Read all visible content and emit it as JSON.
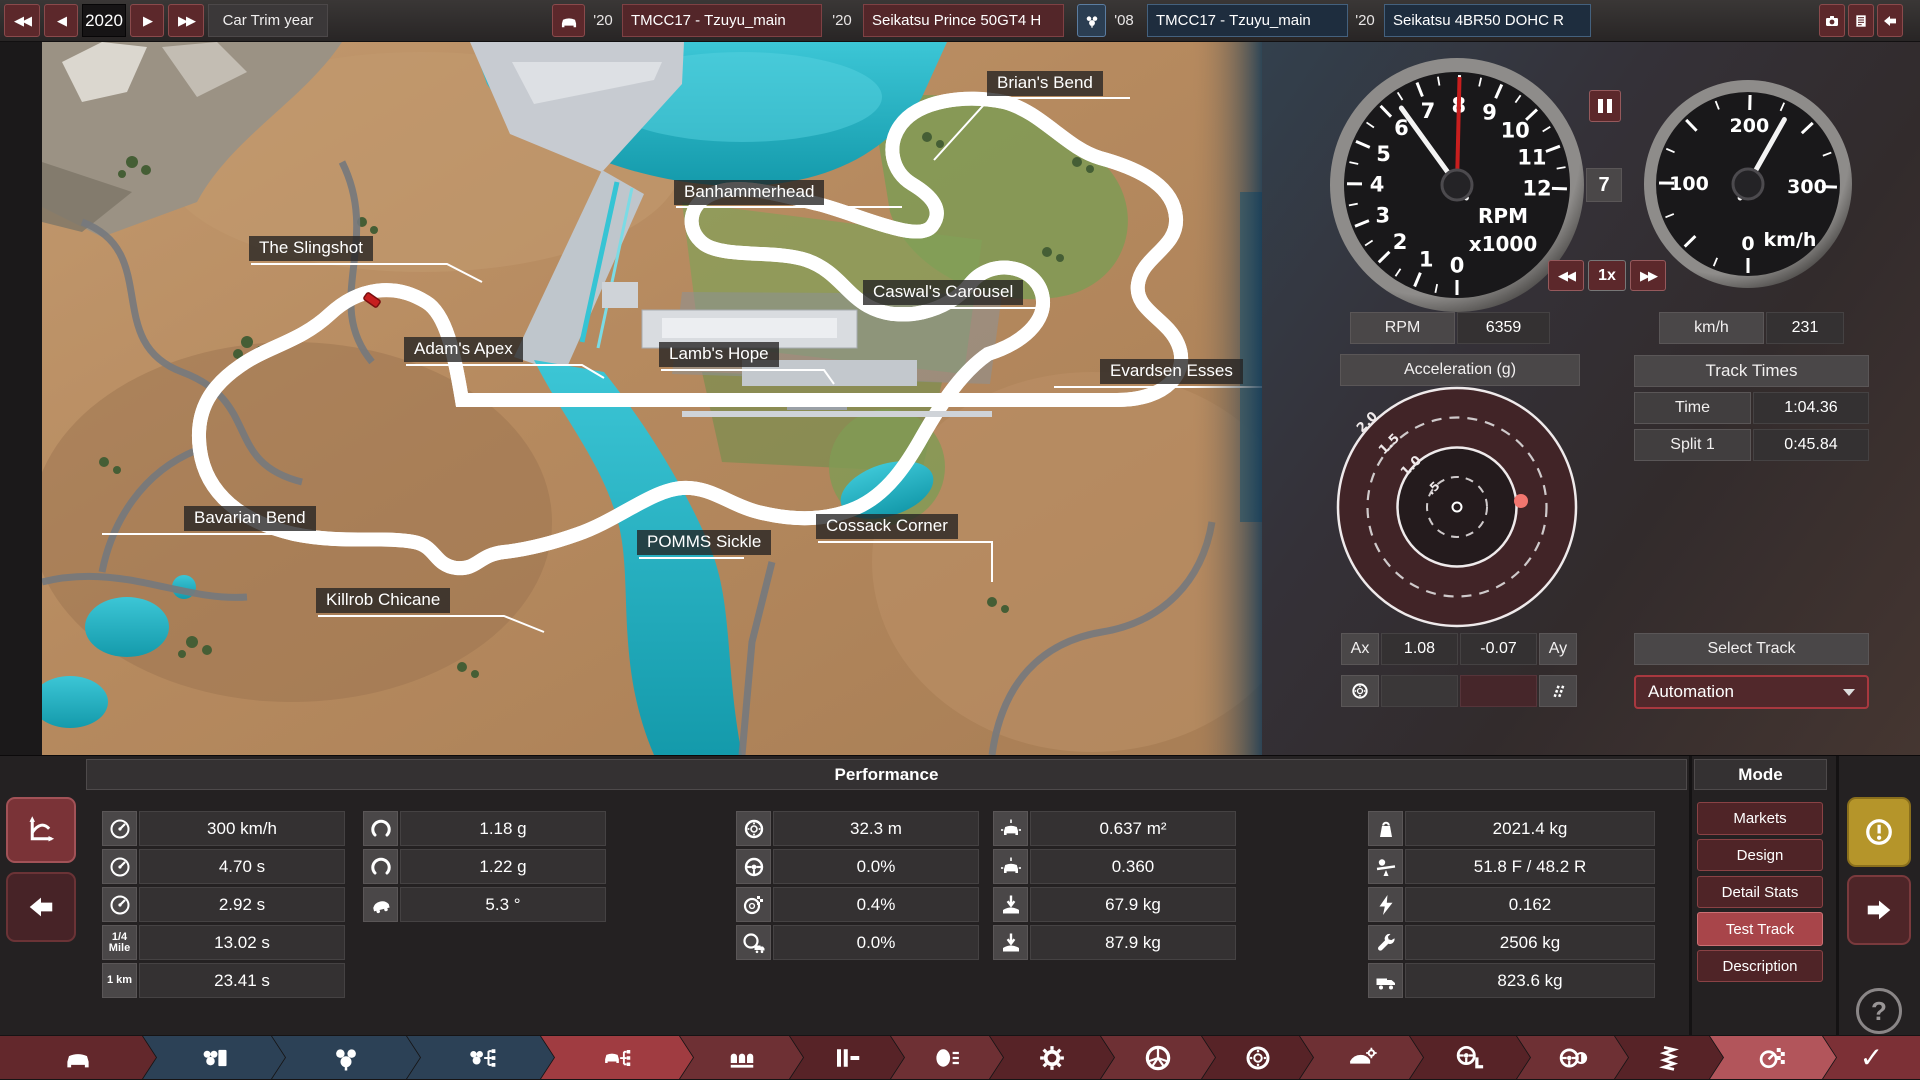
{
  "colors": {
    "accent_red": "#a03c41",
    "active_mode": "#a8454a",
    "warning_yellow": "#b5952a",
    "navy_tab": "#2c4156",
    "gmeter_dot": "#f2766f"
  },
  "top_bar": {
    "year": "2020",
    "year_nav_label": "Car Trim year",
    "tabs": [
      {
        "tag": "'20",
        "label": "TMCC17 - Tzuyu_main"
      },
      {
        "tag": "'20",
        "label": "Seikatsu Prince 50GT4 H"
      },
      {
        "tag": "'08",
        "label": "TMCC17 - Tzuyu_main"
      },
      {
        "tag": "'20",
        "label": "Seikatsu 4BR50 DOHC R"
      }
    ]
  },
  "map": {
    "corners": [
      {
        "name": "Brian's Bend"
      },
      {
        "name": "Banhammerhead"
      },
      {
        "name": "The Slingshot"
      },
      {
        "name": "Caswal's Carousel"
      },
      {
        "name": "Adam's Apex"
      },
      {
        "name": "Lamb's Hope"
      },
      {
        "name": "Evardsen Esses"
      },
      {
        "name": "Bavarian Bend"
      },
      {
        "name": "Cossack Corner"
      },
      {
        "name": "POMMS Sickle"
      },
      {
        "name": "Killrob Chicane"
      }
    ]
  },
  "dash": {
    "gear": "7",
    "playback_speed": "1x",
    "rpm_label": "RPM",
    "rpm_value": "6359",
    "kmh_label": "km/h",
    "kmh_value": "231",
    "accel_header": "Acceleration (g)",
    "g_rings": [
      "2.0",
      "1.5",
      "1.0",
      ".5"
    ],
    "track_times_header": "Track Times",
    "time_label": "Time",
    "time_value": "1:04.36",
    "split_label": "Split 1",
    "split_value": "0:45.84",
    "ax_label": "Ax",
    "ax_value": "1.08",
    "ay_value": "-0.07",
    "ay_label": "Ay",
    "select_track_label": "Select Track",
    "track_name": "Automation"
  },
  "gauges": {
    "tach": {
      "min": 0,
      "max": 12,
      "minor": 0.5,
      "major": 1,
      "value": 6.359,
      "redline": 8.0,
      "fs": 21,
      "labels": [
        {
          "v": 0,
          "t": "0"
        },
        {
          "v": 1,
          "t": "1"
        },
        {
          "v": 2,
          "t": "2"
        },
        {
          "v": 3,
          "t": "3"
        },
        {
          "v": 4,
          "t": "4"
        },
        {
          "v": 5,
          "t": "5"
        },
        {
          "v": 6,
          "t": "6"
        },
        {
          "v": 7,
          "t": "7"
        },
        {
          "v": 8,
          "t": "8"
        },
        {
          "v": 9,
          "t": "9"
        },
        {
          "v": 10,
          "t": "10"
        },
        {
          "v": 11,
          "t": "11"
        },
        {
          "v": 12,
          "t": "12"
        }
      ],
      "unit1": "RPM",
      "unit2": "x1000"
    },
    "speedo": {
      "min": 0,
      "max": 300,
      "minor": 25,
      "major": 50,
      "value": 231,
      "redline": null,
      "fs": 19,
      "labels": [
        {
          "v": 0,
          "t": "0"
        },
        {
          "v": 100,
          "t": "100"
        },
        {
          "v": 200,
          "t": "200"
        },
        {
          "v": 300,
          "t": "300"
        }
      ],
      "unit1": "km/h",
      "unit2": ""
    }
  },
  "performance": {
    "title": "Performance",
    "columns": [
      {
        "rows": [
          {
            "icon": "top-speed",
            "value": "300 km/h"
          },
          {
            "icon": "accel-0-100",
            "value": "4.70 s"
          },
          {
            "icon": "accel-80-120",
            "value": "2.92 s"
          },
          {
            "icon": "quarter-mile",
            "icon_text": "1/4 Mile",
            "value": "13.02 s"
          },
          {
            "icon": "one-km",
            "icon_text": "1 km",
            "value": "23.41 s"
          }
        ]
      },
      {
        "rows": [
          {
            "icon": "cornering-20m",
            "value": "1.18 g"
          },
          {
            "icon": "cornering-200m",
            "value": "1.22 g"
          },
          {
            "icon": "body-roll",
            "value": "5.3 °"
          }
        ]
      },
      {
        "rows": [
          {
            "icon": "braking-distance",
            "value": "32.3 m"
          },
          {
            "icon": "brake-bias",
            "value": "0.0%"
          },
          {
            "icon": "brake-fade",
            "value": "0.4%"
          },
          {
            "icon": "brake-fade-towing",
            "value": "0.0%"
          }
        ]
      },
      {
        "rows": [
          {
            "icon": "frontal-area",
            "value": "0.637 m²"
          },
          {
            "icon": "drag-coefficient",
            "value": "0.360"
          },
          {
            "icon": "downforce-front",
            "value": "67.9 kg"
          },
          {
            "icon": "downforce-rear",
            "value": "87.9 kg"
          }
        ]
      },
      {
        "rows": [
          {
            "icon": "weight",
            "value": "2021.4 kg"
          },
          {
            "icon": "weight-distribution",
            "value": "51.8 F / 48.2 R"
          },
          {
            "icon": "power-to-weight",
            "value": "0.162"
          },
          {
            "icon": "max-load",
            "value": "2506 kg"
          },
          {
            "icon": "towing-capacity",
            "value": "823.6 kg"
          }
        ]
      }
    ]
  },
  "mode": {
    "header": "Mode",
    "buttons": [
      {
        "label": "Markets"
      },
      {
        "label": "Design"
      },
      {
        "label": "Detail Stats"
      },
      {
        "label": "Test Track",
        "active": true
      },
      {
        "label": "Description"
      }
    ]
  },
  "toolbar": {
    "tabs": [
      "car-body",
      "engine-family",
      "engine-variant",
      "engine-tuning",
      "car-trim",
      "interior",
      "gearbox",
      "lights",
      "drivetrain",
      "wheels",
      "brakes",
      "aero",
      "driving-aids",
      "brake-setup",
      "suspension",
      "test-track",
      "finish"
    ],
    "check_glyph": "✓"
  },
  "misc": {
    "help_glyph": "?"
  }
}
